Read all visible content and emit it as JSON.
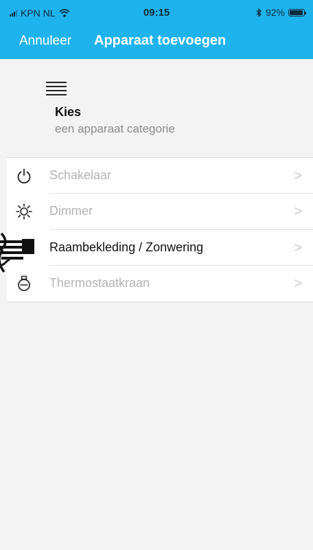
{
  "status": {
    "carrier": "KPN NL",
    "time": "09:15",
    "battery": "92%",
    "battery_level": 0.92
  },
  "nav": {
    "cancel": "Annuleer",
    "title": "Apparaat toevoegen"
  },
  "header": {
    "title": "Kies",
    "subtitle": "een apparaat categorie"
  },
  "categories": [
    {
      "label": "Schakelaar",
      "icon": "power-icon",
      "chevron": ">"
    },
    {
      "label": "Dimmer",
      "icon": "sun-icon",
      "chevron": ">"
    },
    {
      "label": "Raambekleding / Zonwering",
      "icon": "blinds-icon",
      "chevron": ">"
    },
    {
      "label": "Thermostaatkraan",
      "icon": "thermostat-valve-icon",
      "chevron": ">"
    }
  ]
}
